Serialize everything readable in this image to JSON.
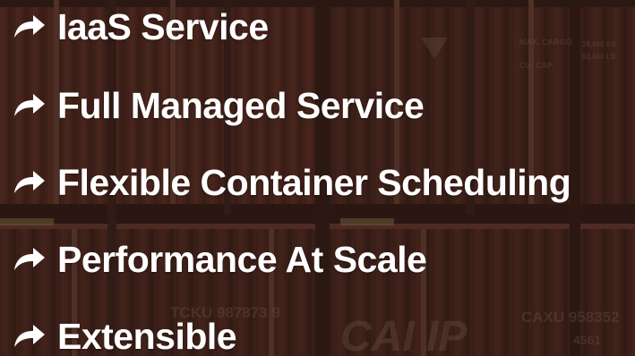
{
  "features": [
    {
      "label": "IaaS Service",
      "icon": "share-arrow-icon"
    },
    {
      "label": "Full Managed Service",
      "icon": "share-arrow-icon"
    },
    {
      "label": "Flexible Container Scheduling",
      "icon": "share-arrow-icon"
    },
    {
      "label": "Performance At Scale",
      "icon": "share-arrow-icon"
    },
    {
      "label": "Extensible",
      "icon": "share-arrow-icon"
    }
  ],
  "background": {
    "subject": "shipping-containers-photo",
    "container_markings": [
      "TCKU 987873 9",
      "CAXU 958352",
      "4561",
      "CAI IP",
      "MAX. CARGO",
      "CU. CAP.",
      "TARE"
    ]
  },
  "colors": {
    "text": "#ffffff",
    "overlay": "#2a1a16",
    "container_red": "#7a3a2c",
    "container_dark": "#4a2620"
  }
}
